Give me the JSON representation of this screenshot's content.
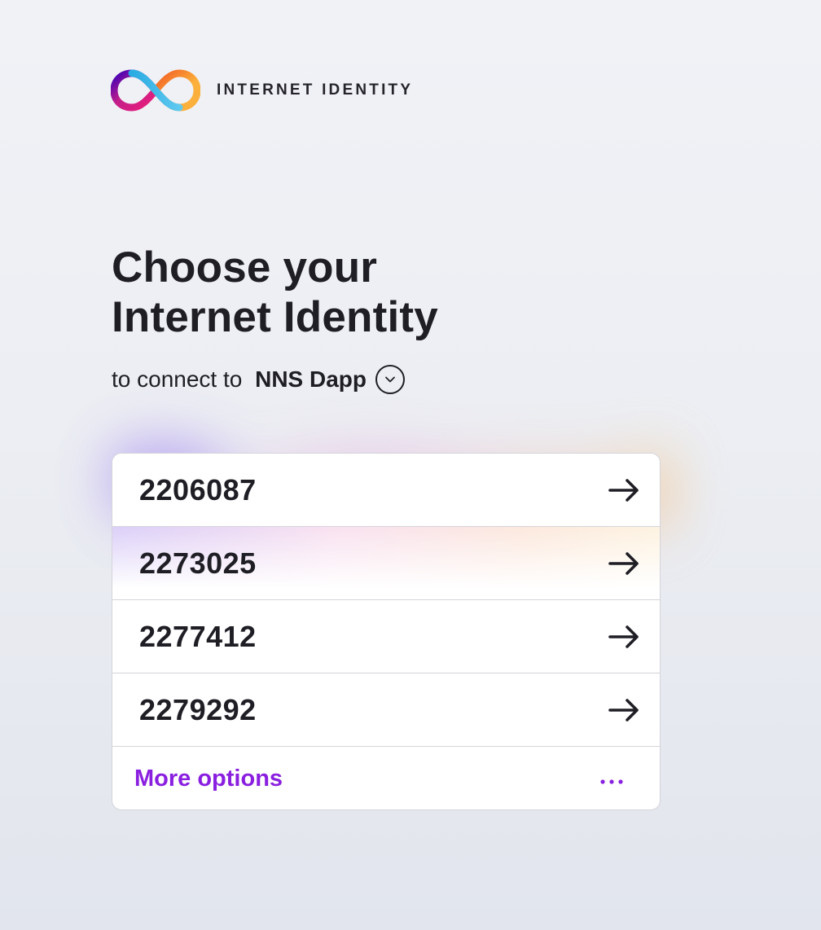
{
  "brand": {
    "name": "INTERNET IDENTITY",
    "logo_icon": "infinity-logo-icon"
  },
  "heading": {
    "line1": "Choose your",
    "line2": "Internet Identity"
  },
  "subtitle": {
    "prefix": "to connect to ",
    "app_name": "NNS Dapp",
    "toggle_icon": "chevron-down-icon"
  },
  "identities": [
    {
      "number": "2206087",
      "icon": "arrow-right-icon"
    },
    {
      "number": "2273025",
      "icon": "arrow-right-icon"
    },
    {
      "number": "2277412",
      "icon": "arrow-right-icon"
    },
    {
      "number": "2279292",
      "icon": "arrow-right-icon"
    }
  ],
  "more_options": {
    "label": "More options",
    "icon": "more-dots-icon"
  },
  "colors": {
    "text": "#1f1e25",
    "accent": "#8a1fe0",
    "border": "#d4d4db",
    "background": "#eceef3"
  }
}
